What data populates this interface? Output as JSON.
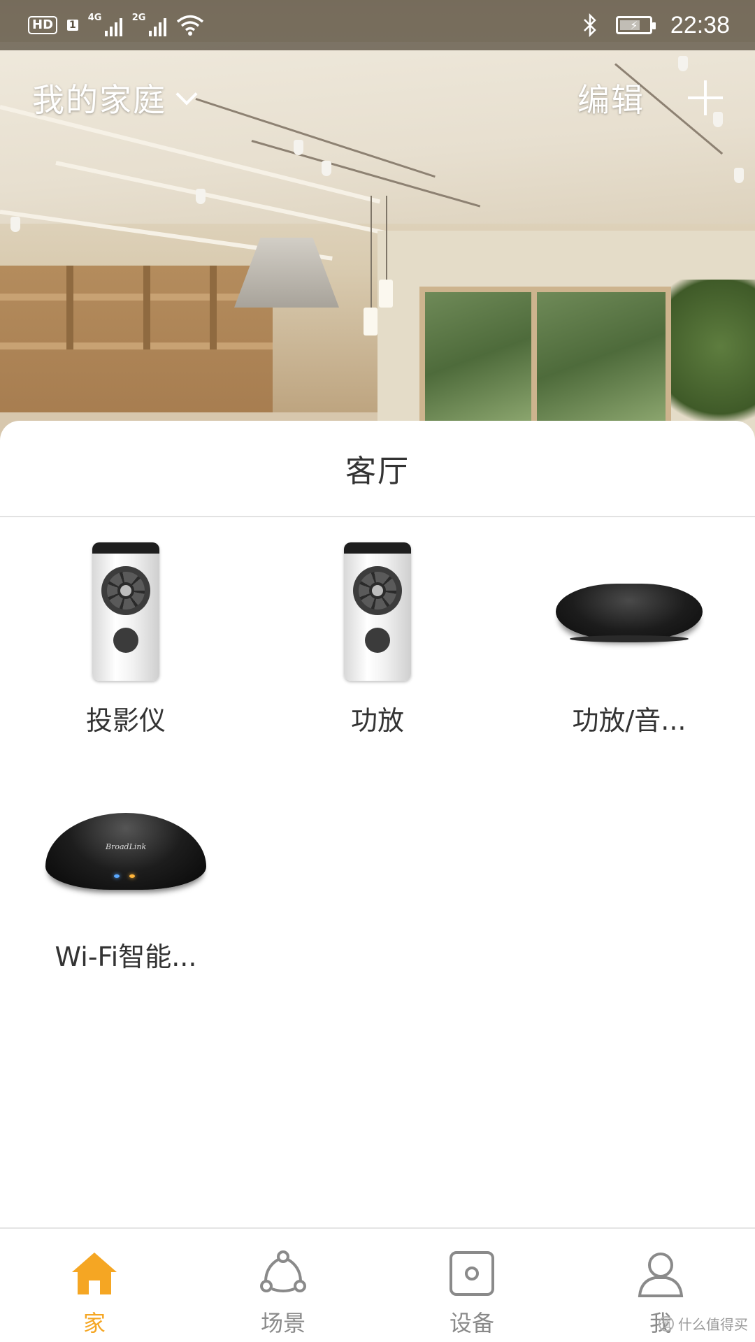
{
  "status_bar": {
    "hd_badge": "HD",
    "sim1": "1",
    "net1": "4G",
    "net2": "2G",
    "wifi_icon": "wifi-icon",
    "bluetooth_icon": "bluetooth-icon",
    "battery_icon": "battery-charging-icon",
    "time": "22:38"
  },
  "header": {
    "home_title": "我的家庭",
    "edit_label": "编辑",
    "dropdown_icon": "chevron-down-icon",
    "add_icon": "plus-icon"
  },
  "room": {
    "title": "客厅",
    "devices": [
      {
        "name": "投影仪",
        "icon": "remote-control-icon"
      },
      {
        "name": "功放",
        "icon": "remote-control-icon"
      },
      {
        "name": "功放/音...",
        "icon": "tv-box-icon"
      },
      {
        "name": "Wi-Fi智能...",
        "icon": "broadlink-hub-icon",
        "logo_text": "BroadLink"
      }
    ]
  },
  "bottom_nav": {
    "items": [
      {
        "label": "家",
        "icon": "home-icon",
        "active": true
      },
      {
        "label": "场景",
        "icon": "scene-icon",
        "active": false
      },
      {
        "label": "设备",
        "icon": "device-icon",
        "active": false
      },
      {
        "label": "我",
        "icon": "user-icon",
        "active": false
      }
    ]
  },
  "watermark": {
    "badge": "值",
    "text": "什么值得买"
  },
  "colors": {
    "accent": "#f5a623",
    "nav_inactive": "#8a8a8a",
    "text": "#333333"
  }
}
